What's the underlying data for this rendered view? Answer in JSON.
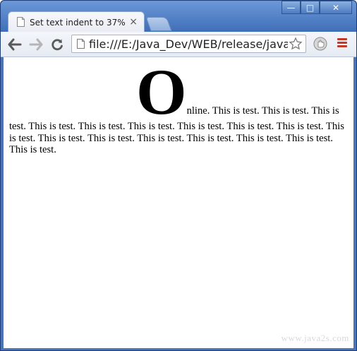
{
  "window": {
    "tab_title": "Set text indent to 37%",
    "tab_close": "×",
    "controls": {
      "minimize": "—",
      "maximize": "□",
      "close": "✕"
    }
  },
  "toolbar": {
    "url": "file:///E:/Java_Dev/WEB/release/java2sID"
  },
  "page": {
    "dropcap": "O",
    "text": "nline. This is test. This is test. This is test. This is test. This is test. This is test. This is test. This is test. This is test. This is test. This is test. This is test. This is test. This is test. This is test. This is test. This is test."
  },
  "watermark": "www.java2s.com",
  "icons": [
    "page-icon",
    "back-arrow-icon",
    "forward-arrow-icon",
    "reload-icon",
    "star-icon",
    "extension-icon",
    "menu-icon"
  ]
}
